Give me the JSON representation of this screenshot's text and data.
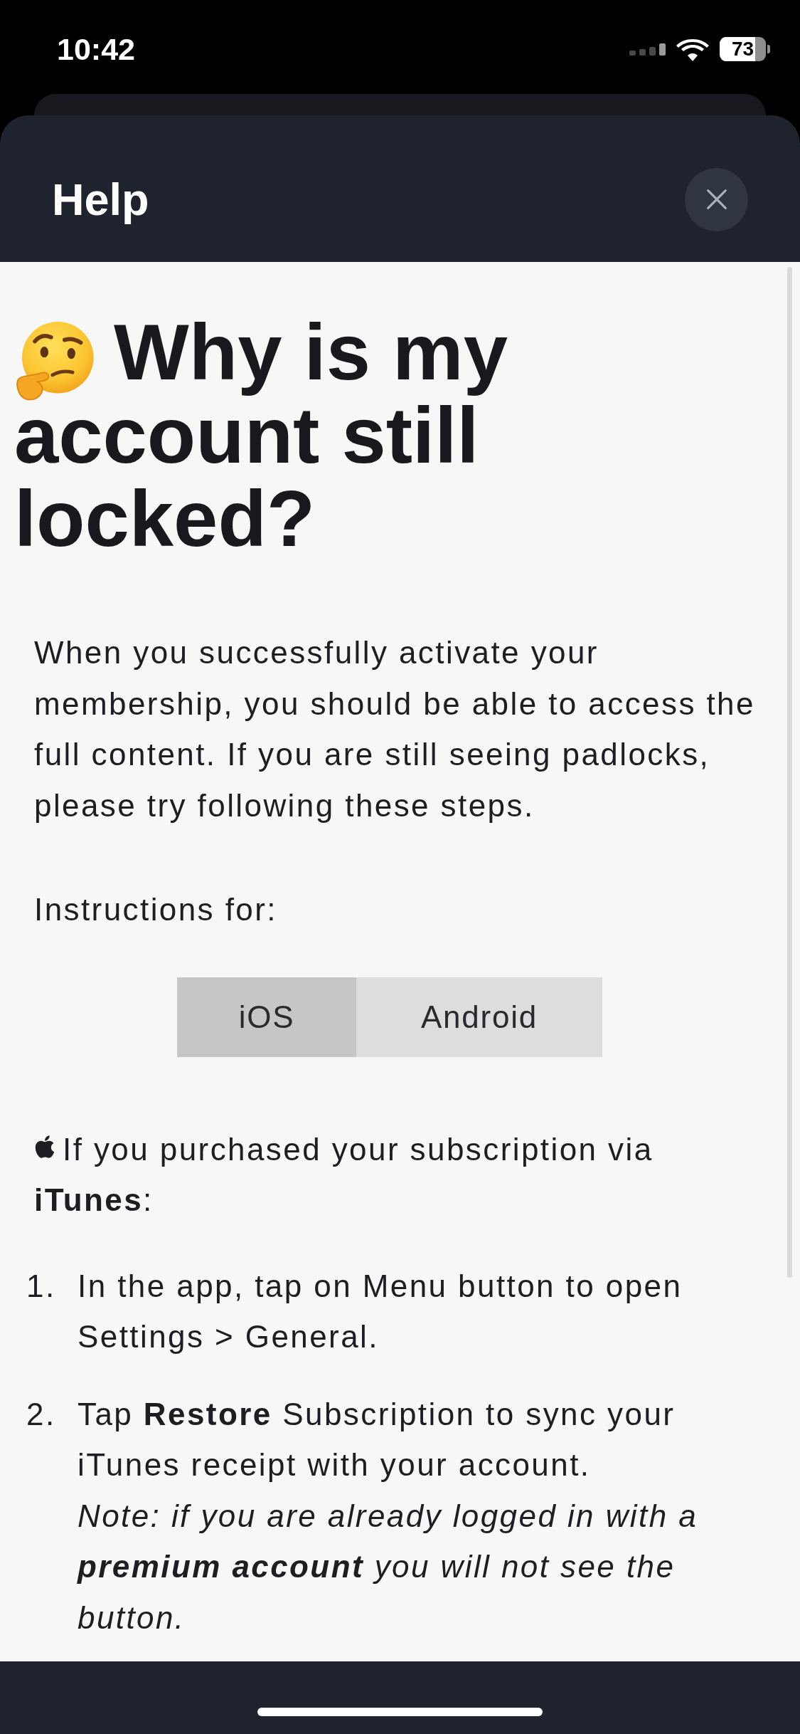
{
  "status_bar": {
    "time": "10:42",
    "battery": "73"
  },
  "header": {
    "title": "Help"
  },
  "article": {
    "title_lines": [
      "Why is my",
      "account still locked?"
    ],
    "intro": "When you successfully activate your membership, you should be able to access the full content. If you are still seeing padlocks, please try following these steps.",
    "instructions_label": "Instructions for:",
    "platform_tabs": [
      {
        "label": "iOS",
        "selected": true
      },
      {
        "label": "Android",
        "selected": false
      }
    ],
    "section_heading_lines": [
      "If you purchased your subscription via",
      "**iTunes**:"
    ],
    "steps": [
      {
        "number": "1.",
        "text": "In the app, tap on Menu button to open Settings > General."
      },
      {
        "number": "2.",
        "text": "Tap **Restore** Subscription to sync your iTunes receipt with your account.",
        "note": "Note: if you are already logged in with a **premium account** you will not see the button."
      }
    ]
  }
}
